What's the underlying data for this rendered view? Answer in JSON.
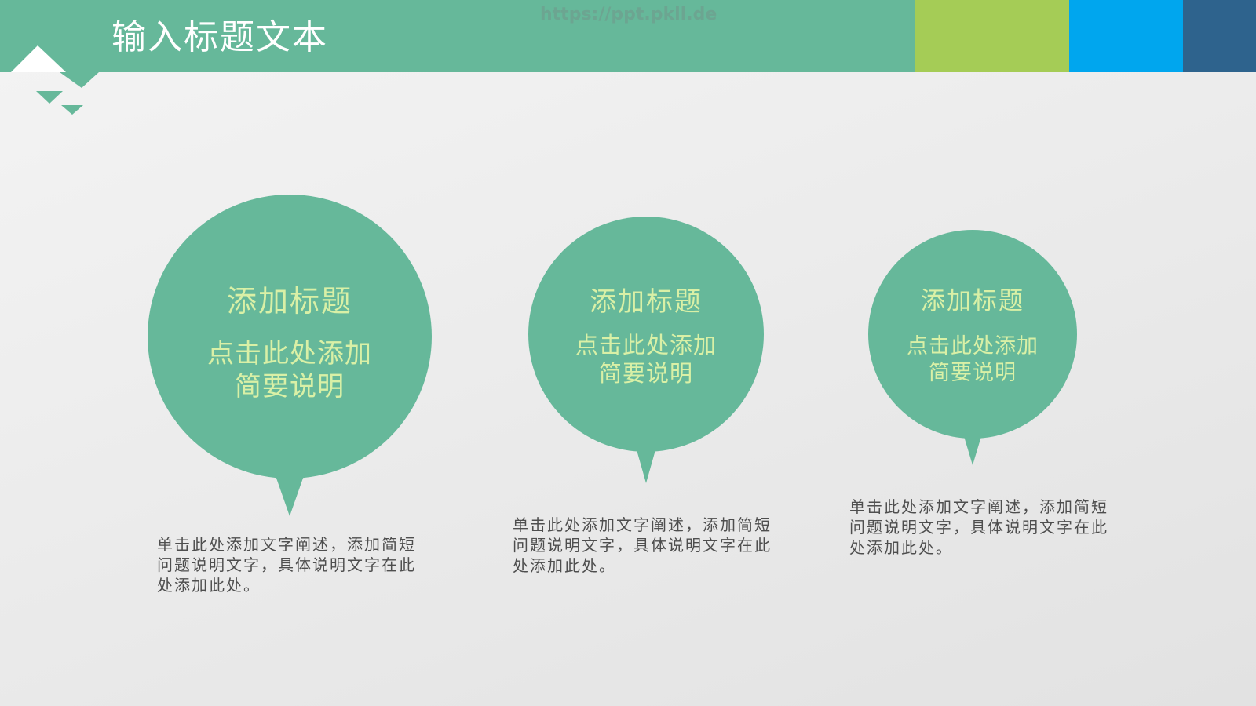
{
  "header": {
    "title": "输入标题文本",
    "watermark": "https://ppt.pkll.de",
    "colors": {
      "green": "#66b89a",
      "lime": "#a5cc56",
      "blue": "#00a6ee",
      "navy": "#2e638d"
    }
  },
  "cards": [
    {
      "title": "添加标题",
      "subtitle_line1": "点击此处添加",
      "subtitle_line2": "简要说明",
      "description": "单击此处添加文字阐述，添加简短问题说明文字，具体说明文字在此处添加此处。"
    },
    {
      "title": "添加标题",
      "subtitle_line1": "点击此处添加",
      "subtitle_line2": "简要说明",
      "description": "单击此处添加文字阐述，添加简短问题说明文字，具体说明文字在此处添加此处。"
    },
    {
      "title": "添加标题",
      "subtitle_line1": "点击此处添加",
      "subtitle_line2": "简要说明",
      "description": "单击此处添加文字阐述，添加简短问题说明文字，具体说明文字在此处添加此处。"
    }
  ],
  "theme": {
    "bubble_color": "#66b89a",
    "bubble_text_color": "#d9f0a6",
    "description_color": "#4e4e4e"
  }
}
